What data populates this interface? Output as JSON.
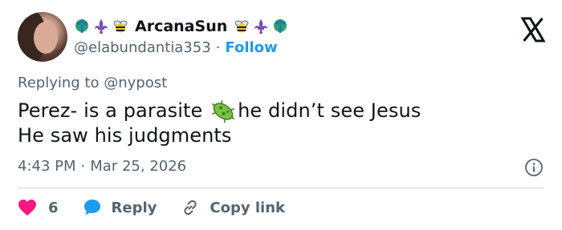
{
  "tweet": {
    "display_name": "ArcanaSun",
    "handle": "@elabundantia353",
    "follow_label": "Follow",
    "separator": "·",
    "replying_prefix": "Replying to",
    "replying_to": "@nypost",
    "text_line1_before_emoji": "Perez- is a parasite ",
    "text_line1_after_emoji": "he didn’t see Jesus",
    "text_line2": "He saw his judgments",
    "time": "4:43 PM",
    "date": "Mar 25, 2026",
    "name_emojis": [
      "peacock-emoji",
      "fleur-de-lis-emoji",
      "bee-emoji",
      "bee-emoji",
      "fleur-de-lis-emoji",
      "peacock-emoji"
    ],
    "body_emoji": "microbe-emoji"
  },
  "actions": {
    "like_count": "6",
    "reply_label": "Reply",
    "copy_link_label": "Copy link"
  },
  "colors": {
    "accent": "#1d9bf0",
    "like": "#f91880",
    "muted": "#536471",
    "text": "#0f1419",
    "divider": "#cfd9de"
  }
}
